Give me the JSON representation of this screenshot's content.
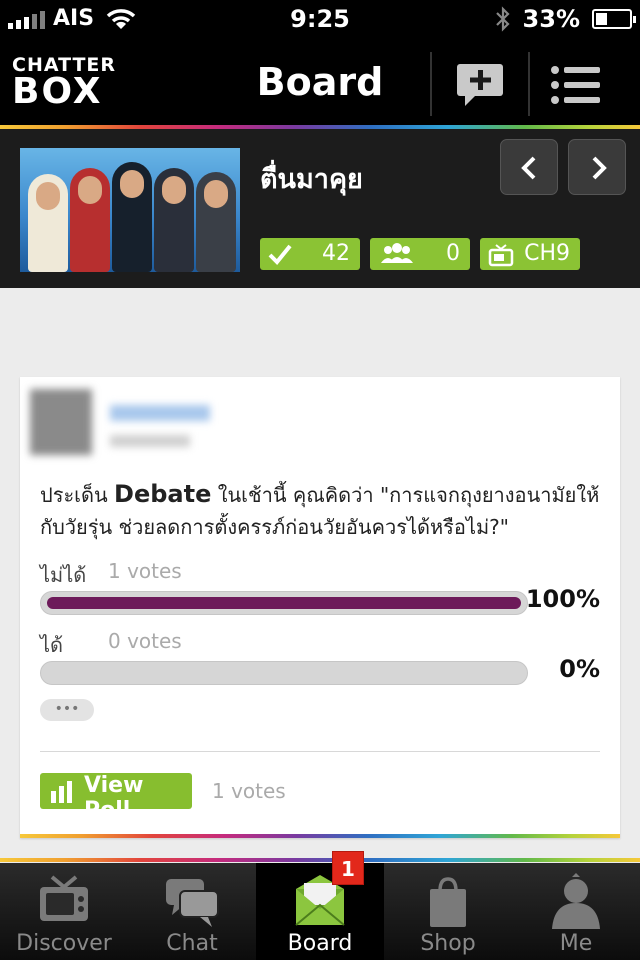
{
  "status_bar": {
    "carrier": "AIS",
    "time": "9:25",
    "battery": "33%",
    "battery_level": 0.33
  },
  "nav": {
    "logo_line1": "CHATTER",
    "logo_line2": "BOX",
    "title": "Board",
    "icons": [
      "compose-icon",
      "menu-icon"
    ]
  },
  "show": {
    "title": "ตื่นมาคุย",
    "checkins": "42",
    "members": "0",
    "channel": "CH9"
  },
  "post": {
    "question_prefix": "ประเด็น",
    "question_highlight": "Debate",
    "question_rest": "ในเช้านี้ คุณคิดว่า \"การแจกถุงยางอนามัยให้กับวัยรุ่น ช่วยลดการตั้งครรภ์ก่อนวัยอันควรได้หรือไม่?\"",
    "options": [
      {
        "label": "ไม่ได้",
        "votes": "1 votes",
        "percent": "100%",
        "fraction": 1.0
      },
      {
        "label": "ได้",
        "votes": "0 votes",
        "percent": "0%",
        "fraction": 0.0
      }
    ],
    "more": "•••",
    "view_poll": "View Poll",
    "total_votes": "1 votes"
  },
  "tabbar": {
    "tabs": [
      {
        "label": "Discover",
        "icon": "tv-icon"
      },
      {
        "label": "Chat",
        "icon": "chat-bubbles-icon"
      },
      {
        "label": "Board",
        "icon": "envelope-board-icon"
      },
      {
        "label": "Shop",
        "icon": "shopping-bag-icon"
      },
      {
        "label": "Me",
        "icon": "person-icon"
      }
    ],
    "active": "Board",
    "board_notification": "1"
  },
  "colors": {
    "accent_green": "#8bc334",
    "poll_bar": "#6d1a5a",
    "notification": "#e2281b"
  }
}
